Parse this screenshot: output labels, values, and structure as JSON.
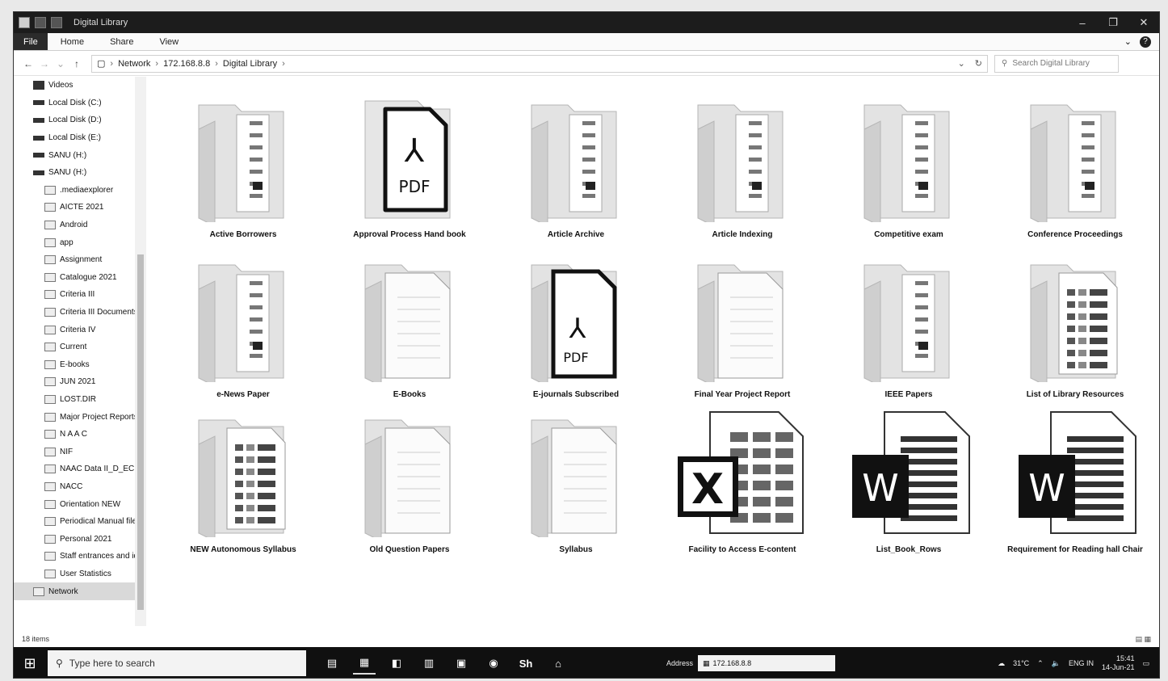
{
  "window": {
    "title": "Digital Library",
    "controls": [
      "–",
      "❐",
      "✕"
    ]
  },
  "ribbon": {
    "tabs": [
      "File",
      "Home",
      "Share",
      "View"
    ]
  },
  "address": {
    "crumbs": [
      "Network",
      "172.168.8.8",
      "Digital Library"
    ],
    "search_placeholder": "Search Digital Library"
  },
  "navpane": {
    "items": [
      {
        "label": "Videos",
        "icon": "video-icon"
      },
      {
        "label": "Local Disk (C:)",
        "icon": "drive-icon"
      },
      {
        "label": "Local Disk (D:)",
        "icon": "drive-icon"
      },
      {
        "label": "Local Disk (E:)",
        "icon": "drive-icon"
      },
      {
        "label": "SANU (H:)",
        "icon": "drive-icon"
      },
      {
        "label": "SANU (H:)",
        "icon": "drive-icon"
      },
      {
        "label": ".mediaexplorer",
        "icon": "folder-icon"
      },
      {
        "label": "AICTE 2021",
        "icon": "folder-icon"
      },
      {
        "label": "Android",
        "icon": "folder-icon"
      },
      {
        "label": "app",
        "icon": "folder-icon"
      },
      {
        "label": "Assignment",
        "icon": "folder-icon"
      },
      {
        "label": "Catalogue 2021",
        "icon": "folder-icon"
      },
      {
        "label": "Criteria III",
        "icon": "folder-icon"
      },
      {
        "label": "Criteria III Documents",
        "icon": "folder-icon"
      },
      {
        "label": "Criteria IV",
        "icon": "folder-icon"
      },
      {
        "label": "Current",
        "icon": "folder-icon"
      },
      {
        "label": "E-books",
        "icon": "folder-icon"
      },
      {
        "label": "JUN 2021",
        "icon": "folder-icon"
      },
      {
        "label": "LOST.DIR",
        "icon": "folder-icon"
      },
      {
        "label": "Major Project Reports",
        "icon": "folder-icon"
      },
      {
        "label": "N A A C",
        "icon": "folder-icon"
      },
      {
        "label": "NIF",
        "icon": "folder-icon"
      },
      {
        "label": "NAAC Data II_D_ECE",
        "icon": "folder-icon"
      },
      {
        "label": "NACC",
        "icon": "folder-icon"
      },
      {
        "label": "Orientation NEW",
        "icon": "folder-icon"
      },
      {
        "label": "Periodical Manual file",
        "icon": "folder-icon"
      },
      {
        "label": "Personal 2021",
        "icon": "folder-icon"
      },
      {
        "label": "Staff entrances and id",
        "icon": "folder-icon"
      },
      {
        "label": "User Statistics",
        "icon": "folder-icon"
      },
      {
        "label": "Network",
        "icon": "network-icon",
        "selected": true
      }
    ]
  },
  "files": [
    {
      "label": "Active Borrowers",
      "kind": "folder"
    },
    {
      "label": "Approval Process Hand book",
      "kind": "pdf"
    },
    {
      "label": "Article Archive",
      "kind": "folder"
    },
    {
      "label": "Article Indexing",
      "kind": "folder"
    },
    {
      "label": "Competitive exam",
      "kind": "folder"
    },
    {
      "label": "Conference Proceedings",
      "kind": "folder"
    },
    {
      "label": "e-News Paper",
      "kind": "folder"
    },
    {
      "label": "E-Books",
      "kind": "folder-doc"
    },
    {
      "label": "E-journals Subscribed",
      "kind": "folder-pdf"
    },
    {
      "label": "Final Year Project Report",
      "kind": "folder-doc"
    },
    {
      "label": "IEEE Papers",
      "kind": "folder"
    },
    {
      "label": "List of Library Resources",
      "kind": "folder-sheet"
    },
    {
      "label": "NEW Autonomous Syllabus",
      "kind": "folder-sheet"
    },
    {
      "label": "Old Question Papers",
      "kind": "folder-doc"
    },
    {
      "label": "Syllabus",
      "kind": "folder-doc"
    },
    {
      "label": "Facility to Access E-content",
      "kind": "excel"
    },
    {
      "label": "List_Book_Rows",
      "kind": "word"
    },
    {
      "label": "Requirement for Reading hall Chair",
      "kind": "word"
    }
  ],
  "status": {
    "count": "18 items"
  },
  "taskbar": {
    "search_placeholder": "Type here to search",
    "apps": [
      "▤",
      "▦",
      "◧",
      "▥",
      "▣",
      "◉",
      "Sh",
      "⌂"
    ],
    "address_label": "Address",
    "address_value": "172.168.8.8",
    "temperature": "31°C",
    "language": "ENG IN",
    "time": "15:41",
    "date": "14-Jun-21"
  }
}
